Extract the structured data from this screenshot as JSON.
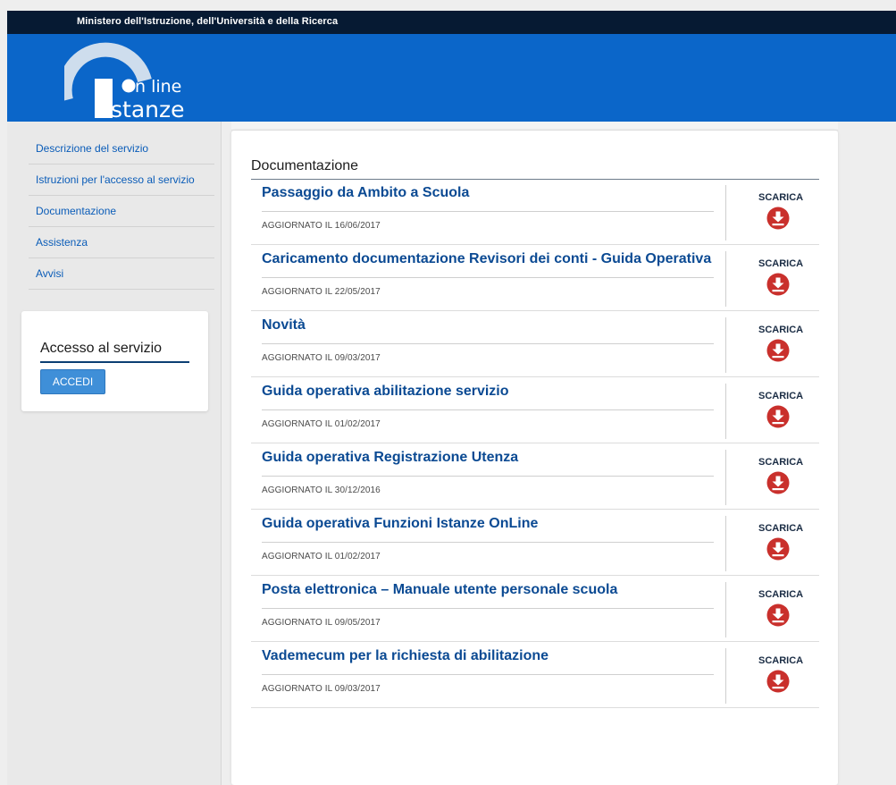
{
  "topbar": {
    "ministry": "Ministero dell'Istruzione, dell'Università e della Ricerca"
  },
  "logo": {
    "line1": "n line",
    "line2": "stanze"
  },
  "sidebar": {
    "items": [
      {
        "label": "Descrizione del servizio"
      },
      {
        "label": "Istruzioni per l'accesso al servizio"
      },
      {
        "label": "Documentazione"
      },
      {
        "label": "Assistenza"
      },
      {
        "label": "Avvisi"
      }
    ],
    "access": {
      "title": "Accesso al servizio",
      "button": "ACCEDI"
    }
  },
  "main": {
    "section_title": "Documentazione",
    "download_label": "SCARICA",
    "documents": [
      {
        "title": "Passaggio da Ambito a Scuola",
        "updated": "AGGIORNATO IL 16/06/2017"
      },
      {
        "title": "Caricamento documentazione Revisori dei conti - Guida Operativa",
        "updated": "AGGIORNATO IL 22/05/2017"
      },
      {
        "title": "Novità",
        "updated": "AGGIORNATO IL 09/03/2017"
      },
      {
        "title": "Guida operativa abilitazione servizio",
        "updated": "AGGIORNATO IL 01/02/2017"
      },
      {
        "title": "Guida operativa Registrazione Utenza",
        "updated": "AGGIORNATO IL 30/12/2016"
      },
      {
        "title": "Guida operativa Funzioni Istanze OnLine",
        "updated": "AGGIORNATO IL 01/02/2017"
      },
      {
        "title": "Posta elettronica – Manuale utente personale scuola",
        "updated": "AGGIORNATO IL 09/05/2017"
      },
      {
        "title": "Vademecum per la richiesta di abilitazione",
        "updated": "AGGIORNATO IL 09/03/2017"
      }
    ]
  },
  "colors": {
    "header_blue": "#0b66c9",
    "topbar_navy": "#061a33",
    "link_blue": "#0b4a93",
    "download_red": "#c9302c"
  },
  "icons": {
    "download": "download-circle-icon"
  }
}
